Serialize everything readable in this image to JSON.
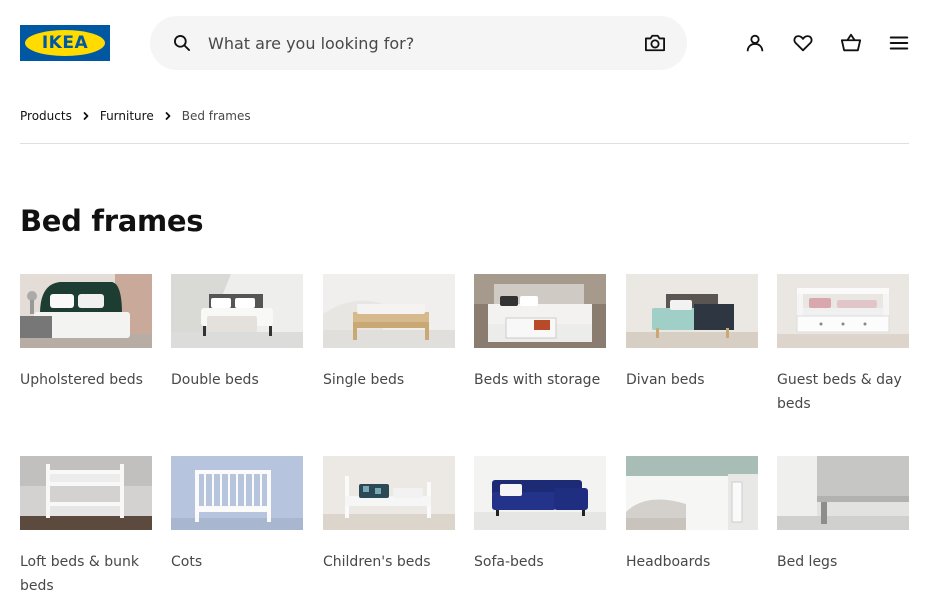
{
  "header": {
    "logo_text": "IKEA",
    "search_placeholder": "What are you looking for?"
  },
  "breadcrumb": [
    "Products",
    "Furniture",
    "Bed frames"
  ],
  "page_title": "Bed frames",
  "categories": [
    "Upholstered beds",
    "Double beds",
    "Single beds",
    "Beds with storage",
    "Divan beds",
    "Guest beds & day beds",
    "Loft beds & bunk beds",
    "Cots",
    "Children's beds",
    "Sofa-beds",
    "Headboards",
    "Bed legs"
  ],
  "colors": {
    "brand_blue": "#0058a3",
    "brand_yellow": "#ffdb00",
    "search_bg": "#f5f5f5"
  }
}
